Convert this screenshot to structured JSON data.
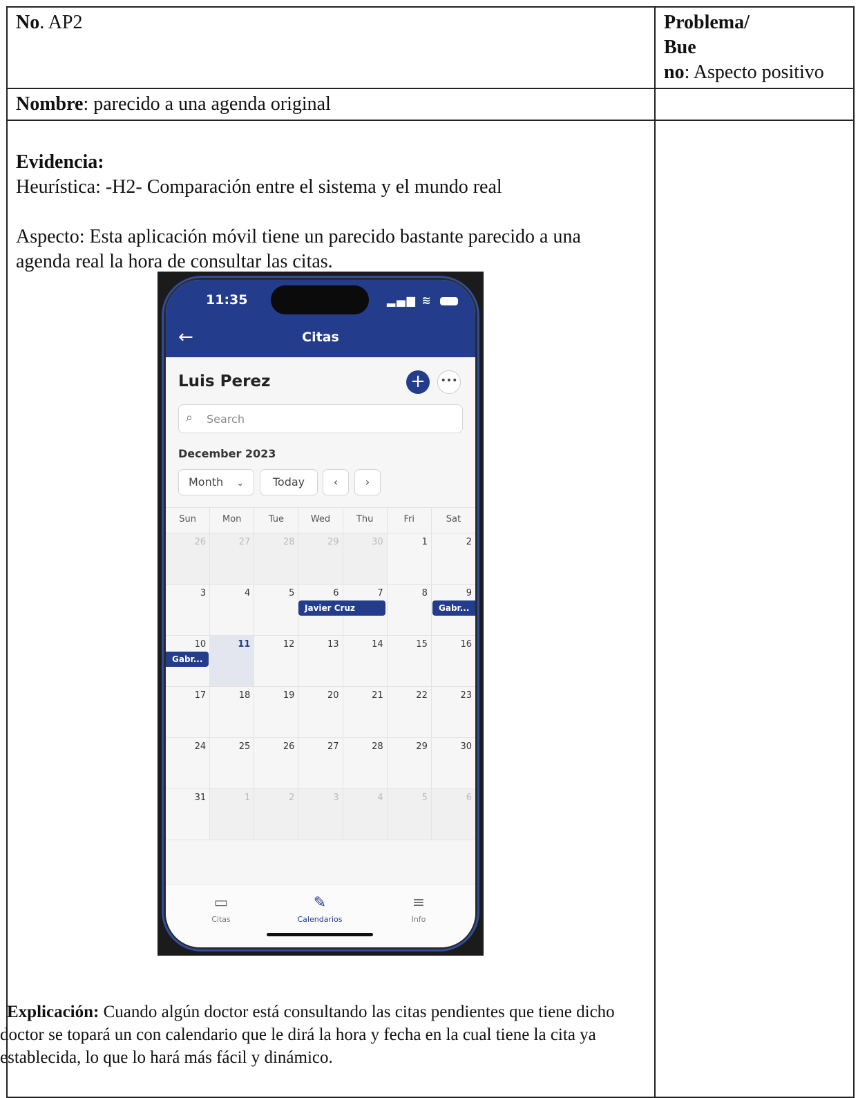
{
  "document": {
    "no_label": "No",
    "no_value": ". AP2",
    "problem_line1": "Problema/",
    "problem_line2": "Bue",
    "problem_line3_bold": "no",
    "problem_line3_rest": ":  Aspecto positivo",
    "nombre_label": "Nombre",
    "nombre_value": ": parecido a una agenda original",
    "evidencia_label": "Evidencia:",
    "heuristica": "Heurística: -H2- Comparación entre el sistema y el mundo real",
    "aspecto": "Aspecto: Esta aplicación móvil tiene un parecido bastante parecido a una agenda real la hora de consultar las citas.",
    "explicacion_label": "Explicación:",
    "explicacion_text": " Cuando algún doctor está consultando las citas pendientes que tiene dicho doctor se topará un con calendario que le dirá la hora y fecha en la cual tiene la cita ya establecida, lo que lo hará más fácil y dinámico."
  },
  "phone": {
    "time": "11:35",
    "title": "Citas",
    "user_name": "Luis Perez",
    "search_placeholder": "Search",
    "month_year": "December 2023",
    "view_select": "Month",
    "today_button": "Today",
    "weekdays": [
      "Sun",
      "Mon",
      "Tue",
      "Wed",
      "Thu",
      "Fri",
      "Sat"
    ],
    "weeks": [
      [
        "26",
        "27",
        "28",
        "29",
        "30",
        "1",
        "2"
      ],
      [
        "3",
        "4",
        "5",
        "6",
        "7",
        "8",
        "9"
      ],
      [
        "10",
        "11",
        "12",
        "13",
        "14",
        "15",
        "16"
      ],
      [
        "17",
        "18",
        "19",
        "20",
        "21",
        "22",
        "23"
      ],
      [
        "24",
        "25",
        "26",
        "27",
        "28",
        "29",
        "30"
      ],
      [
        "31",
        "1",
        "2",
        "3",
        "4",
        "5",
        "6"
      ]
    ],
    "events": [
      {
        "label": "Javier Cruz"
      },
      {
        "label": "Gabr..."
      },
      {
        "label": "Gabr..."
      }
    ],
    "tabs": [
      {
        "label": "Citas"
      },
      {
        "label": "Calendarios"
      },
      {
        "label": "Info"
      }
    ],
    "accent_color": "#233c8c"
  }
}
